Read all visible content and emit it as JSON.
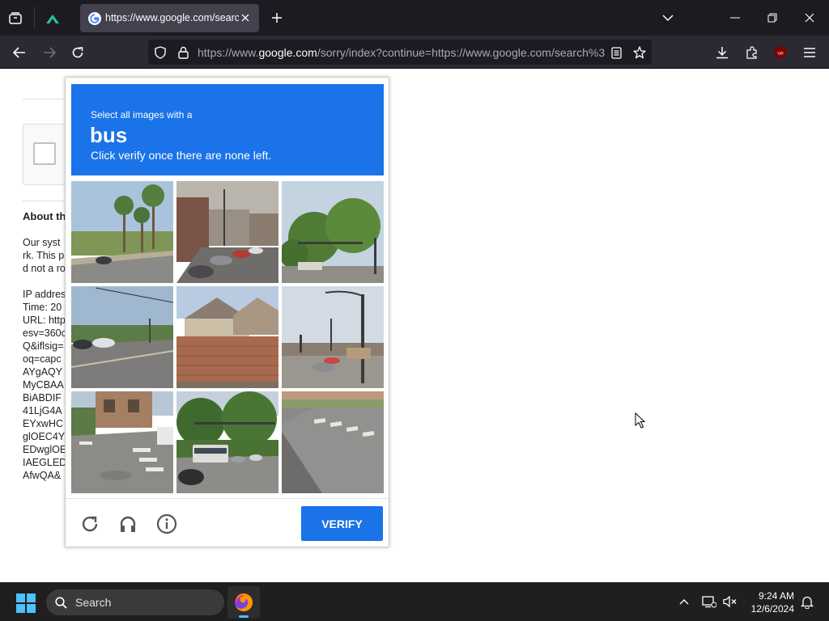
{
  "browser": {
    "tab_title": "https://www.google.com/search",
    "url_prefix": "https://www.",
    "url_domain": "google.com",
    "url_rest": "/sorry/index?continue=https://www.google.com/search%3..."
  },
  "background_page": {
    "heading": "About th",
    "paragraph_lines": [
      "Our syst",
      "rk. This p",
      "d not a ro"
    ],
    "details_lines": [
      "IP addres",
      "Time: 20",
      "URL: http",
      "esv=360c",
      "Q&iflsig=",
      "oq=capc",
      "AYgAQY",
      "MyCBAA",
      "BiABDIF",
      "41LjG4A",
      "EYxwHC",
      "glOEC4Y",
      "EDwglOE",
      "IAEGLED",
      "AfwQA&"
    ]
  },
  "captcha": {
    "instruction_line1": "Select all images with a",
    "target_word": "bus",
    "instruction_line2": "Click verify once there are none left.",
    "verify_label": "VERIFY",
    "tiles": [
      {
        "name": "palm-trees-road"
      },
      {
        "name": "street-parked-cars"
      },
      {
        "name": "trees-traffic-light"
      },
      {
        "name": "intersection-cars"
      },
      {
        "name": "brick-wall-houses"
      },
      {
        "name": "street-lamp-intersection"
      },
      {
        "name": "crosswalk-corner"
      },
      {
        "name": "bus-on-road"
      },
      {
        "name": "crosswalk-pavement"
      }
    ]
  },
  "taskbar": {
    "search_label": "Search",
    "time": "9:24 AM",
    "date": "12/6/2024"
  },
  "colors": {
    "accent": "#1a73e8",
    "tabbar": "#1c1b22",
    "navbar": "#2b2a33",
    "taskbar": "#1f1f1f"
  }
}
